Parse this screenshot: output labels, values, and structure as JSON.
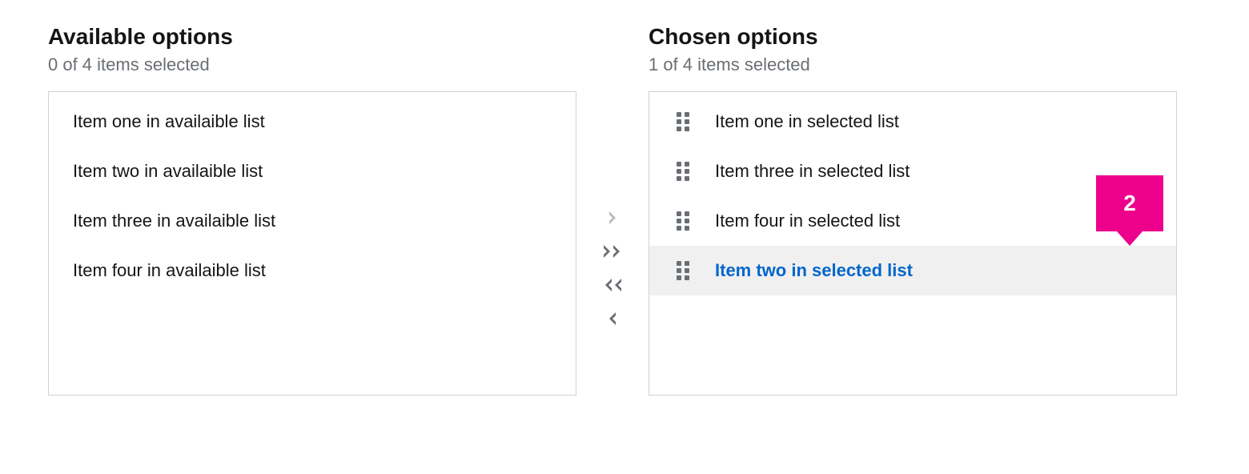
{
  "available": {
    "title": "Available options",
    "status": "0 of 4 items selected",
    "items": [
      {
        "label": "Item one in availaible list"
      },
      {
        "label": "Item two in availaible list"
      },
      {
        "label": "Item three in availaible list"
      },
      {
        "label": "Item four in availaible list"
      }
    ]
  },
  "chosen": {
    "title": "Chosen options",
    "status": "1 of 4 items selected",
    "items": [
      {
        "label": "Item one in selected list"
      },
      {
        "label": "Item three in selected list"
      },
      {
        "label": "Item four in selected list"
      },
      {
        "label": "Item two in selected list",
        "selected": true
      }
    ]
  },
  "callout": {
    "label": "2"
  }
}
